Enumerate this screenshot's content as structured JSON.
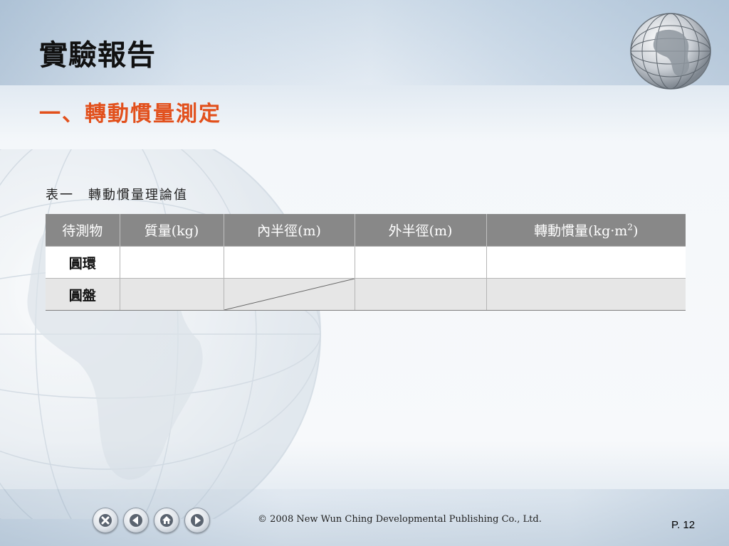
{
  "slide": {
    "title": "實驗報告",
    "subtitle": "一、轉動慣量測定",
    "caption": "表一　轉動慣量理論值"
  },
  "table": {
    "headers": [
      "待測物",
      "質量(kg)",
      "內半徑(m)",
      "外半徑(m)",
      "轉動慣量(kg·m"
    ],
    "header_superscript": "2",
    "header_suffix": ")",
    "rows": [
      [
        "圓環",
        "",
        "",
        "",
        ""
      ],
      [
        "圓盤",
        "",
        "",
        "",
        ""
      ]
    ]
  },
  "footer": {
    "copyright": "© 2008 New Wun Ching Developmental Publishing Co., Ltd.",
    "page": "P. 12",
    "nav_buttons": [
      "close-icon",
      "previous-icon",
      "home-icon",
      "next-icon"
    ]
  },
  "colors": {
    "title": "#111111",
    "subtitle": "#e2501c",
    "table_header_bg": "#888888",
    "row_alt_bg": "#e6e6e6"
  }
}
